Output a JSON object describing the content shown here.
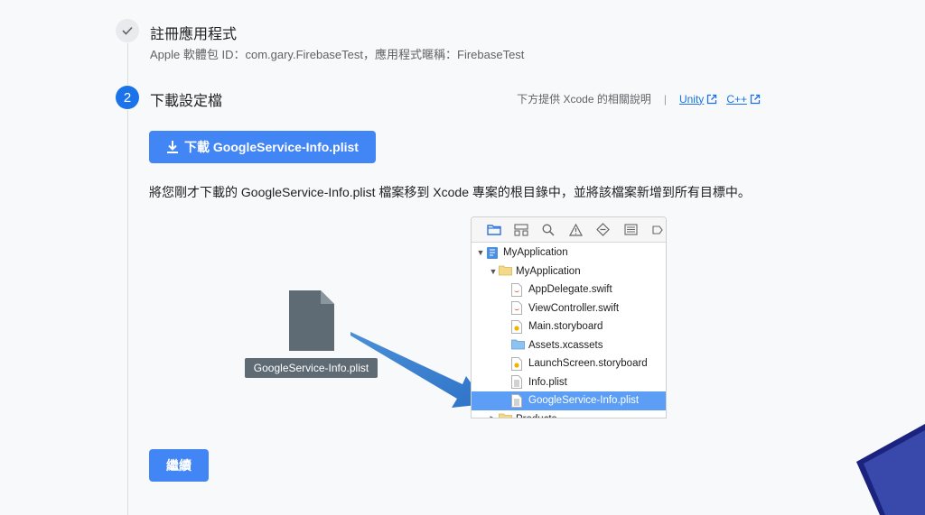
{
  "step1": {
    "number_icon": "check-icon",
    "title": "註冊應用程式",
    "subtitle": "Apple 軟體包 ID：com.gary.FirebaseTest，應用程式暱稱：FirebaseTest"
  },
  "step2": {
    "number": "2",
    "title": "下載設定檔",
    "help_text": "下方提供 Xcode 的相關說明",
    "help_separator": "|",
    "links": [
      "Unity",
      "C++"
    ],
    "download_button": "下載 GoogleService-Info.plist",
    "instruction": "將您剛才下載的 GoogleService-Info.plist 檔案移到 Xcode 專案的根目錄中，並將該檔案新增到所有目標中。",
    "file_label": "GoogleService-Info.plist"
  },
  "xcode": {
    "toolbar_icons": [
      "folder-icon",
      "hierarchy-icon",
      "search-icon",
      "warning-icon",
      "breakpoint-icon",
      "list-icon",
      "tag-icon"
    ],
    "rows": [
      {
        "label": "MyApplication",
        "icon": "project-icon",
        "expanded": true
      },
      {
        "label": "MyApplication",
        "icon": "folder-icon",
        "expanded": true
      },
      {
        "label": "AppDelegate.swift",
        "icon": "swift-file-icon"
      },
      {
        "label": "ViewController.swift",
        "icon": "swift-file-icon"
      },
      {
        "label": "Main.storyboard",
        "icon": "storyboard-icon"
      },
      {
        "label": "Assets.xcassets",
        "icon": "assets-folder-icon"
      },
      {
        "label": "LaunchScreen.storyboard",
        "icon": "storyboard-icon"
      },
      {
        "label": "Info.plist",
        "icon": "plist-icon"
      },
      {
        "label": "GoogleService-Info.plist",
        "icon": "plist-icon",
        "selected": true
      },
      {
        "label": "Products",
        "icon": "folder-icon",
        "expanded": false
      }
    ]
  },
  "continue_button": "繼續",
  "colors": {
    "primary": "#4285f4",
    "link": "#1a73e8",
    "selection": "#5c9ef5"
  }
}
